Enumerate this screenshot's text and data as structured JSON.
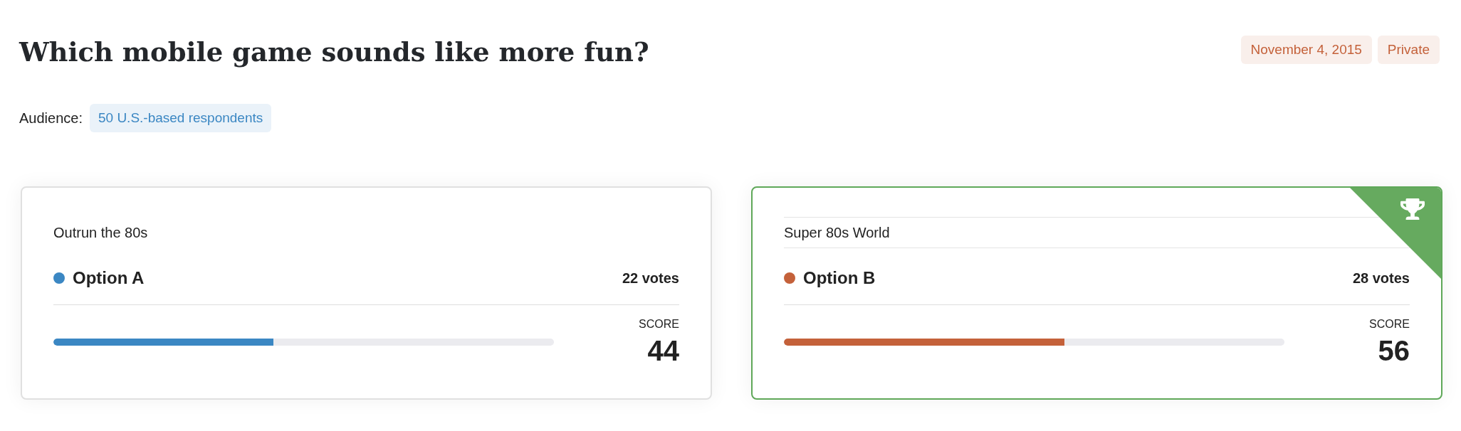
{
  "title": "Which mobile game sounds like more fun?",
  "tags": [
    {
      "label": "November 4, 2015"
    },
    {
      "label": "Private"
    }
  ],
  "audience": {
    "label": "Audience:",
    "value": "50 U.S.-based respondents"
  },
  "options": [
    {
      "name": "Outrun the 80s",
      "label": "Option A",
      "color": "#3b87c3",
      "votes": "22 votes",
      "score_label": "SCORE",
      "score": "44",
      "level": 0.44,
      "winner": false
    },
    {
      "name": "Super 80s World",
      "label": "Option B",
      "color": "#c4613a",
      "votes": "28 votes",
      "score_label": "SCORE",
      "score": "56",
      "level": 0.56,
      "winner": true
    }
  ]
}
